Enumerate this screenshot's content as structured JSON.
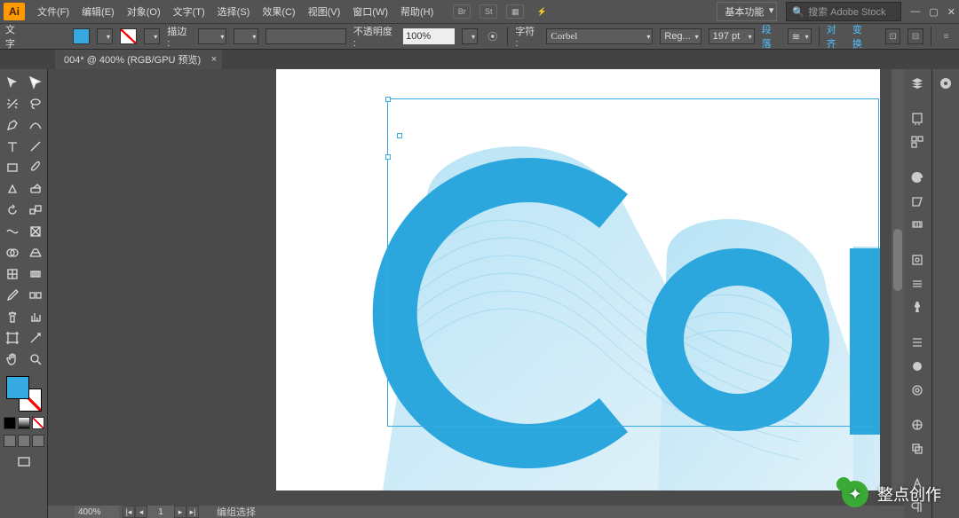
{
  "app_badge": "Ai",
  "menus": [
    "文件(F)",
    "编辑(E)",
    "对象(O)",
    "文字(T)",
    "选择(S)",
    "效果(C)",
    "视图(V)",
    "窗口(W)",
    "帮助(H)"
  ],
  "workspace": "基本功能",
  "stock_placeholder": "搜索 Adobe Stock",
  "min": "—",
  "restore": "▢",
  "close_win": "✕",
  "control": {
    "mode": "文字",
    "stroke_label": "描边 :",
    "opacity_label": "不透明度 :",
    "opacity_value": "100%",
    "char_label": "字符 :",
    "font": "Corbel",
    "font_weight": "Reg...",
    "font_size": "197 pt",
    "para": "段落",
    "align": "对齐",
    "transform": "变换"
  },
  "tab": {
    "title": "004* @ 400% (RGB/GPU 预览)",
    "close": "×"
  },
  "status": {
    "zoom": "400%",
    "mode": "编组选择"
  },
  "watermark": "整点创作"
}
